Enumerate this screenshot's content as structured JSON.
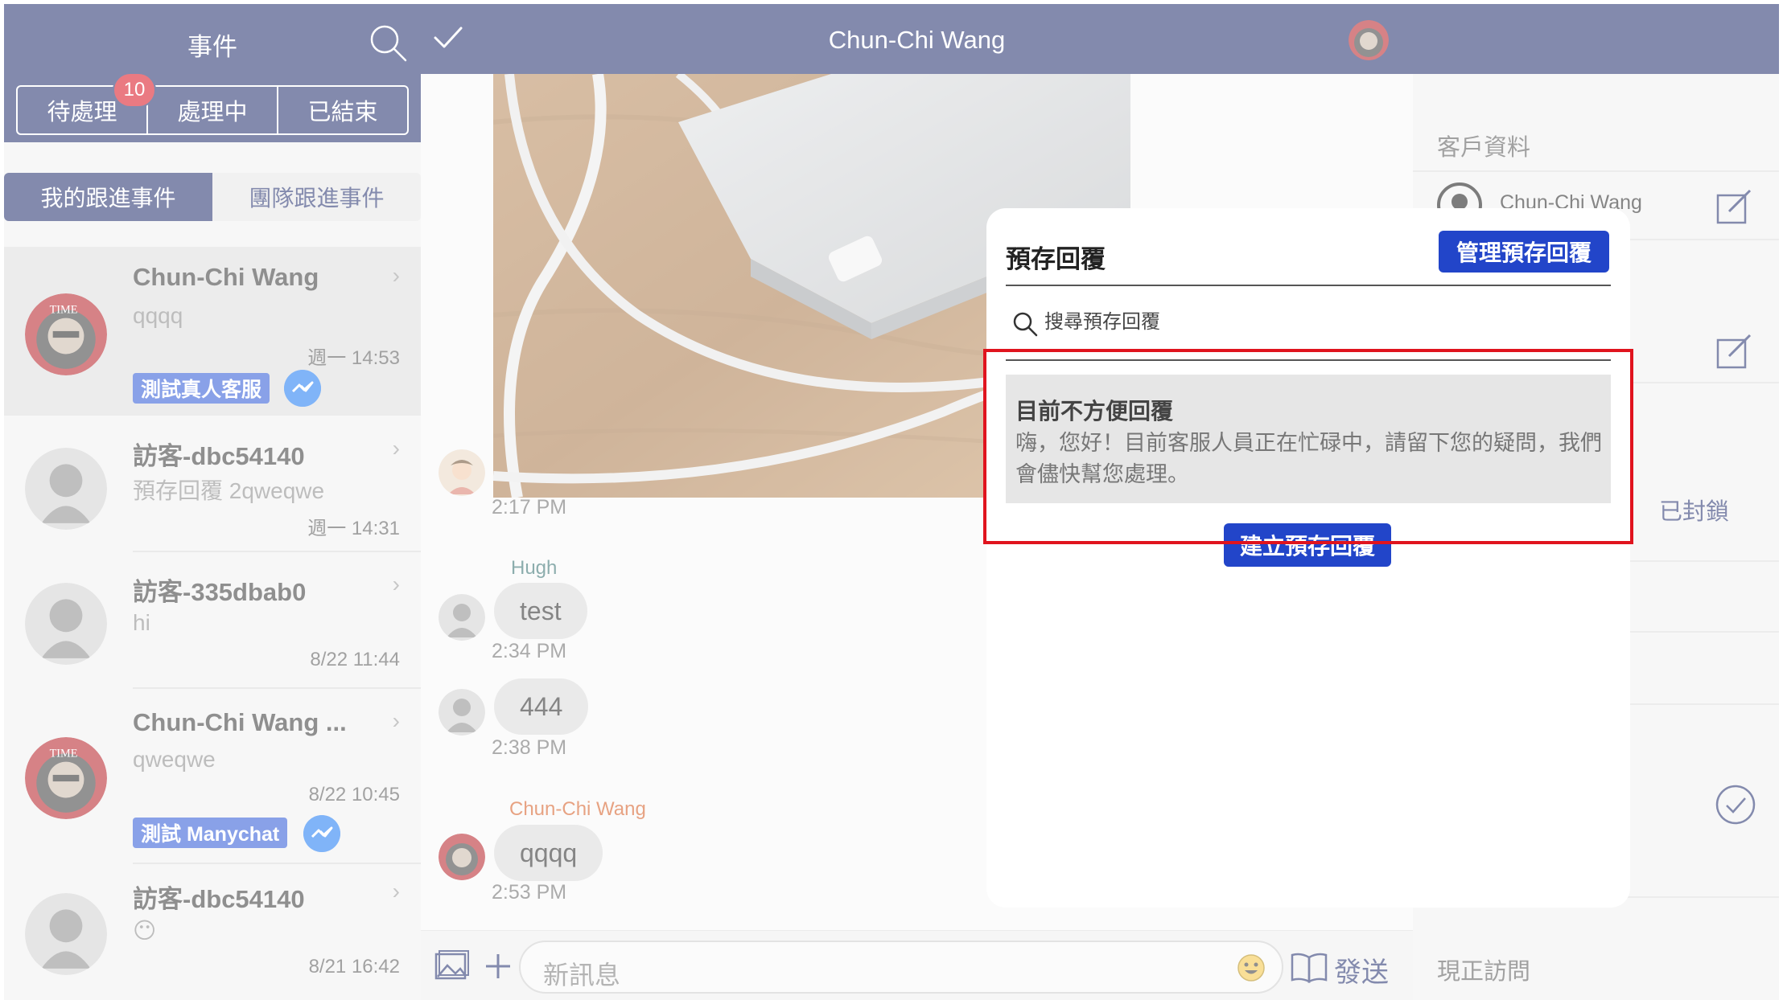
{
  "colors": {
    "navy": "#1e2b6b",
    "badge_red": "#d90d1d",
    "tag_blue": "#2855d6",
    "button_blue": "#2245c9",
    "highlight_red": "#e0141e"
  },
  "left": {
    "title": "事件",
    "status_tabs": [
      "待處理",
      "處理中",
      "已結束"
    ],
    "badge_count": "10",
    "sub_tabs": [
      "我的跟進事件",
      "團隊跟進事件"
    ],
    "conversations": [
      {
        "name": "Chun-Chi Wang",
        "preview": "qqqq",
        "time": "週一 14:53",
        "tag": "測試真人客服",
        "channel_icon": "messenger-icon",
        "selected": true
      },
      {
        "name": "訪客-dbc54140",
        "preview": "預存回覆 2qweqwe",
        "time": "週一 14:31"
      },
      {
        "name": "訪客-335dbab0",
        "preview": "hi",
        "time": "8/22 11:44"
      },
      {
        "name": "Chun-Chi Wang ...",
        "preview": "qweqwe",
        "time": "8/22 10:45",
        "tag": "測試 Manychat",
        "channel_icon": "messenger-icon"
      },
      {
        "name": "訪客-dbc54140",
        "preview": "😶",
        "time": "8/21 16:42"
      }
    ]
  },
  "chat": {
    "title": "Chun-Chi Wang",
    "photo_time": "2:17 PM",
    "messages": [
      {
        "sender": "Hugh",
        "text": "test",
        "time": "2:34 PM"
      },
      {
        "sender": "",
        "text": "444",
        "time": "2:38 PM"
      },
      {
        "sender": "Chun-Chi Wang",
        "text": "qqqq",
        "time": "2:53 PM"
      }
    ],
    "composer_placeholder": "新訊息",
    "send_label": "發送"
  },
  "right": {
    "section_customer": "客戶資料",
    "customer_name": "Chun-Chi Wang",
    "blocked_label": "已封鎖",
    "section_visit": "現正訪問"
  },
  "modal": {
    "title": "預存回覆",
    "manage_button": "管理預存回覆",
    "search_placeholder": "搜尋預存回覆",
    "replies": [
      {
        "title": "目前不方便回覆",
        "body": "嗨，您好！目前客服人員正在忙碌中，請留下您的疑問，我們會儘快幫您處理。"
      }
    ],
    "create_button": "建立預存回覆"
  }
}
